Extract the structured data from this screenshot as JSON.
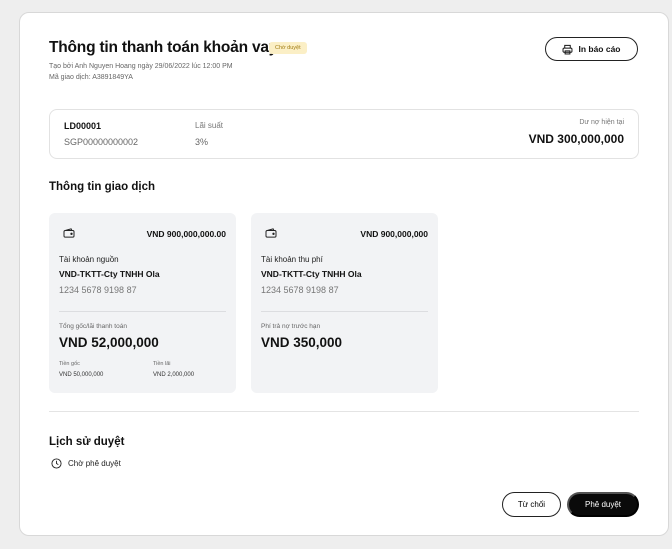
{
  "header": {
    "title": "Thông tin thanh toán khoản vay",
    "status_badge": "Chờ duyệt",
    "created_by": "Tạo bởi Anh Nguyen Hoang ngày 29/06/2022 lúc 12:00 PM",
    "transaction_id": "Mã giao dịch: A3891849YA",
    "print_button": "In báo cáo"
  },
  "loan": {
    "code": "LD00001",
    "account": "SGP00000000002",
    "interest_label": "Lãi suất",
    "interest_value": "3%",
    "balance_label": "Dư nợ hiện tại",
    "balance_value": "VND 300,000,000"
  },
  "transaction_section": {
    "title": "Thông tin giao dịch",
    "source_card": {
      "amount": "VND 900,000,000.00",
      "account_label": "Tài khoản nguồn",
      "account_name": "VND-TKTT-Cty TNHH Ola",
      "account_number": "1234 5678 9198 87",
      "total_label": "Tổng gốc/lãi thanh toán",
      "total_value": "VND 52,000,000",
      "principal_label": "Tiền gốc",
      "principal_value": "VND 50,000,000",
      "interest_label": "Tiền lãi",
      "interest_value": "VND 2,000,000"
    },
    "fee_card": {
      "amount": "VND 900,000,000",
      "account_label": "Tài khoản thu phí",
      "account_name": "VND-TKTT-Cty TNHH Ola",
      "account_number": "1234 5678 9198 87",
      "fee_label": "Phí trả nợ trước hạn",
      "fee_value": "VND 350,000"
    }
  },
  "history": {
    "title": "Lịch sử duyệt",
    "status": "Chờ phê duyệt",
    "status_icon": "clock-icon"
  },
  "actions": {
    "reject": "Từ chối",
    "approve": "Phê duyệt"
  },
  "colors": {
    "badge_bg": "#fbefc6",
    "badge_text": "#a07b12",
    "approve_bg": "#0a0a0a",
    "card_bg": "#f2f3f5"
  }
}
